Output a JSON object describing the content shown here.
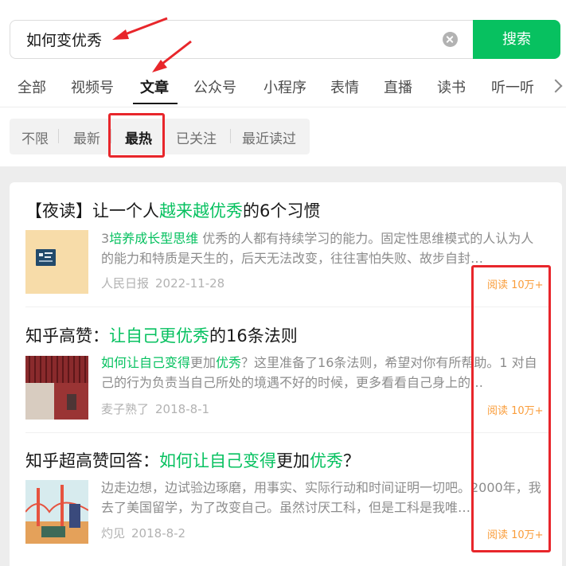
{
  "search": {
    "query": "如何变优秀",
    "button_label": "搜索"
  },
  "tabs": [
    {
      "label": "全部"
    },
    {
      "label": "视频号"
    },
    {
      "label": "文章"
    },
    {
      "label": "公众号"
    },
    {
      "label": "小程序"
    },
    {
      "label": "表情"
    },
    {
      "label": "直播"
    },
    {
      "label": "读书"
    },
    {
      "label": "听一听"
    }
  ],
  "active_tab": "文章",
  "filters": [
    {
      "label": "不限"
    },
    {
      "label": "最新"
    },
    {
      "label": "最热"
    },
    {
      "label": "已关注"
    },
    {
      "label": "最近读过"
    }
  ],
  "active_filter": "最热",
  "results": [
    {
      "title_parts": [
        {
          "text": "【夜读】让一个人",
          "highlight": false
        },
        {
          "text": "越来越优秀",
          "highlight": true
        },
        {
          "text": "的6个习惯",
          "highlight": false
        }
      ],
      "snippet_parts": [
        {
          "text": "3",
          "highlight": false
        },
        {
          "text": "培养成长型思维",
          "highlight": true
        },
        {
          "text": " 优秀的人都有持续学习的能力。固定性思维模式的人认为人的能力和特质是天生的，后天无法改变，往往害怕失败、故步自封…",
          "highlight": false
        }
      ],
      "source": "人民日报",
      "date": "2022-11-28",
      "read_count": "阅读 10万+"
    },
    {
      "title_parts": [
        {
          "text": "知乎高赞：",
          "highlight": false
        },
        {
          "text": "让自己更优秀",
          "highlight": true
        },
        {
          "text": "的16条法则",
          "highlight": false
        }
      ],
      "snippet_parts": [
        {
          "text": "如何让自己变得",
          "highlight": true
        },
        {
          "text": "更加",
          "highlight": false
        },
        {
          "text": "优秀",
          "highlight": true
        },
        {
          "text": "？这里准备了16条法则，希望对你有所帮助。1 对自己的行为负责当自己所处的境遇不好的时候，更多看看自己身上的…",
          "highlight": false
        }
      ],
      "source": "麦子熟了",
      "date": "2018-8-1",
      "read_count": "阅读 10万+"
    },
    {
      "title_parts": [
        {
          "text": "知乎超高赞回答：",
          "highlight": false
        },
        {
          "text": "如何让自己变得",
          "highlight": true
        },
        {
          "text": "更加",
          "highlight": false
        },
        {
          "text": "优秀",
          "highlight": true
        },
        {
          "text": "？",
          "highlight": false
        }
      ],
      "snippet_parts": [
        {
          "text": "边走边想，边试验边琢磨，用事实、实际行动和时间证明一切吧。2000年，我去了美国留学，为了改变自己。虽然讨厌工科，但是工科是我唯…",
          "highlight": false
        }
      ],
      "source": "灼见",
      "date": "2018-8-2",
      "read_count": "阅读 10万+"
    }
  ],
  "colors": {
    "accent": "#07c160",
    "read_count": "#fa9d3b",
    "annotation": "#e8262b"
  }
}
